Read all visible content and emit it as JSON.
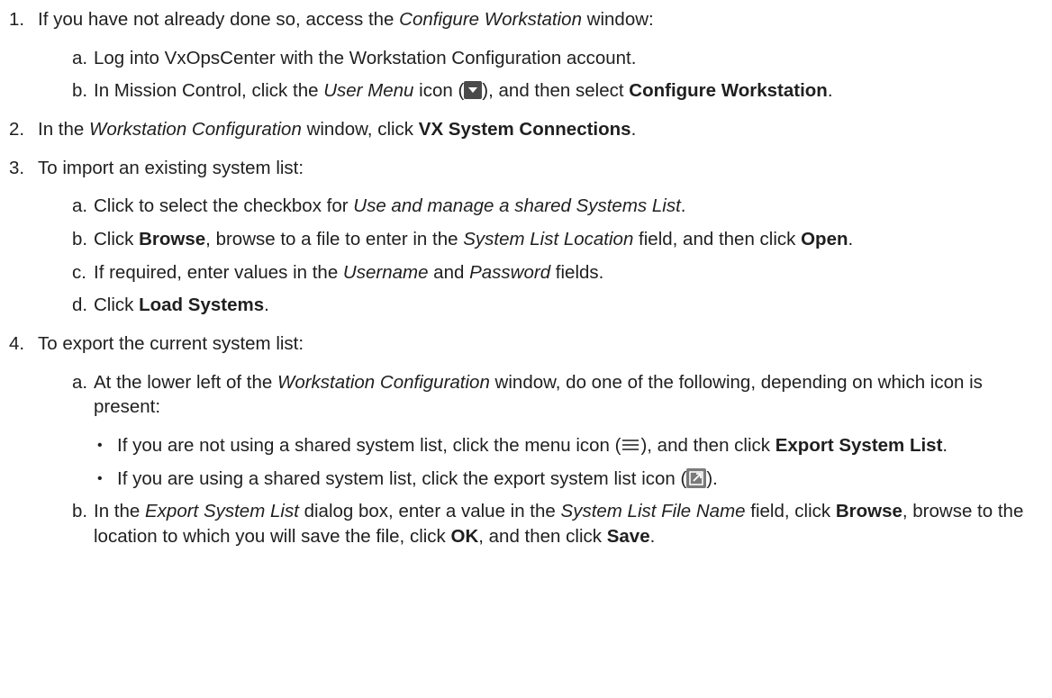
{
  "steps": [
    {
      "num": "1.",
      "text": [
        "If you have not already done so, access the ",
        "Configure Workstation",
        " window:"
      ],
      "subs": [
        {
          "letter": "a.",
          "text": [
            "Log into VxOpsCenter with the Workstation Configuration account."
          ]
        },
        {
          "letter": "b.",
          "text": [
            "In Mission Control, click the ",
            "User Menu",
            " icon (",
            "), and then select ",
            "Configure Workstation",
            "."
          ]
        }
      ]
    },
    {
      "num": "2.",
      "text": [
        "In the ",
        "Workstation Configuration",
        " window, click ",
        "VX System Connections",
        "."
      ]
    },
    {
      "num": "3.",
      "text": [
        "To import an existing system list:"
      ],
      "subs": [
        {
          "letter": "a.",
          "text": [
            "Click to select the checkbox for ",
            "Use and manage a shared Systems List",
            "."
          ]
        },
        {
          "letter": "b.",
          "text": [
            "Click ",
            "Browse",
            ", browse to a file to enter in the ",
            "System List Location",
            " field, and then click ",
            "Open",
            "."
          ]
        },
        {
          "letter": "c.",
          "text": [
            "If required, enter values in the ",
            "Username",
            " and ",
            "Password",
            " fields."
          ]
        },
        {
          "letter": "d.",
          "text": [
            "Click ",
            "Load Systems",
            "."
          ]
        }
      ]
    },
    {
      "num": "4.",
      "text": [
        "To export the current system list:"
      ],
      "subs": [
        {
          "letter": "a.",
          "text": [
            "At the lower left of the ",
            "Workstation Configuration",
            " window, do one of the following, depending on which icon is present:"
          ],
          "bullets": [
            {
              "dot": "•",
              "text": [
                "If you are not using a shared system list, click the menu icon (",
                "), and then click ",
                "Export System List",
                "."
              ]
            },
            {
              "dot": "•",
              "text": [
                "If you are using a shared system list, click the export system list icon (",
                ")."
              ]
            }
          ]
        },
        {
          "letter": "b.",
          "text": [
            "In the ",
            "Export System List",
            " dialog box, enter a value in the ",
            "System List File Name",
            " field, click ",
            "Browse",
            ", browse to the location to which you will save the file, click ",
            "OK",
            ", and then click ",
            "Save",
            "."
          ]
        }
      ]
    }
  ],
  "icons": {
    "user_menu": "user-menu-dropdown-icon",
    "menu": "hamburger-menu-icon",
    "export": "export-system-list-icon"
  }
}
